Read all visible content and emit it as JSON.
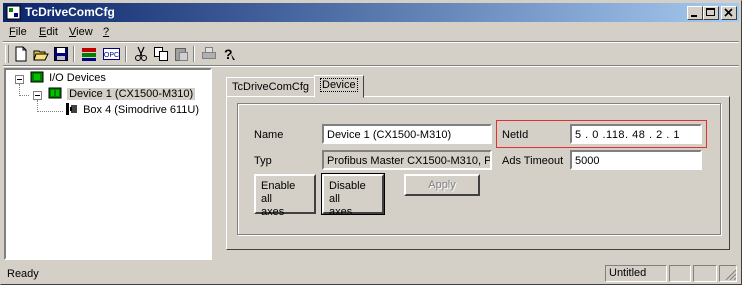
{
  "window": {
    "title": "TcDriveComCfg"
  },
  "menu": {
    "file": {
      "underline": "F",
      "rest": "ile"
    },
    "edit": {
      "underline": "E",
      "rest": "dit"
    },
    "view": {
      "underline": "V",
      "rest": "iew"
    },
    "help": {
      "underline": "?",
      "rest": ""
    }
  },
  "toolbar": {
    "icons": [
      "new-icon",
      "open-icon",
      "save-icon",
      "config-icon",
      "opc-icon",
      "cut-icon",
      "copy-icon",
      "paste-icon",
      "print-icon",
      "help-icon"
    ],
    "opc_label": "OPC"
  },
  "tree": {
    "root": "I/O Devices",
    "device": "Device 1 (CX1500-M310)",
    "box": "Box 4 (Simodrive 611U)"
  },
  "tabs": [
    "TcDriveComCfg",
    "Device"
  ],
  "device_tab": {
    "name_label": "Name",
    "name_value": "Device 1 (CX1500-M310)",
    "typ_label": "Typ",
    "typ_value": "Profibus Master CX1500-M310, P",
    "netid_label": "NetId",
    "netid_value": "5 . 0 .118. 48 . 2 . 1",
    "ads_timeout_label": "Ads Timeout",
    "ads_timeout_value": "5000",
    "enable_all_line1": "Enable all",
    "enable_all_line2": "axes",
    "disable_all_line1": "Disable all",
    "disable_all_line2": "axes",
    "apply_label": "Apply"
  },
  "status": {
    "text": "Ready",
    "document": "Untitled"
  },
  "colors": {
    "titlebar_start": "#0a246a",
    "titlebar_end": "#a6caf0",
    "highlight": "#e03030"
  }
}
